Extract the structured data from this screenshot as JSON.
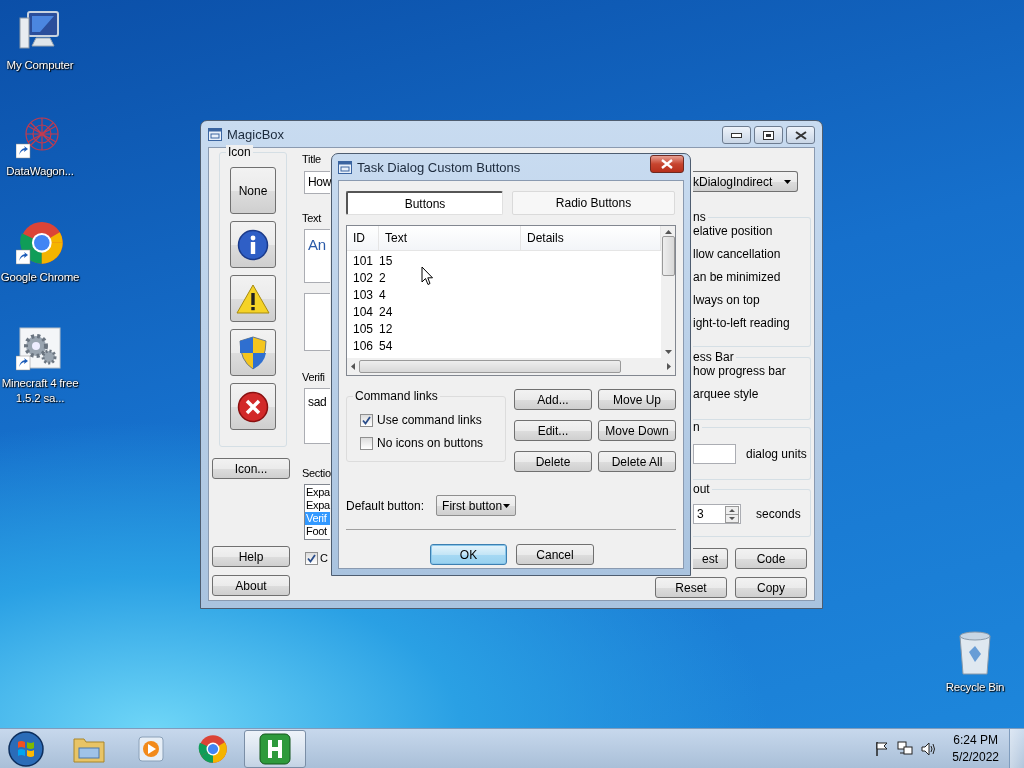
{
  "desktop_icons": [
    {
      "kind": "computer",
      "label": "My Computer",
      "shortcut": false
    },
    {
      "kind": "network",
      "label": "DataWagon...",
      "shortcut": true
    },
    {
      "kind": "chrome",
      "label": "Google Chrome",
      "shortcut": true
    },
    {
      "kind": "gears",
      "label": "Minecraft 4 free 1.5.2 sa...",
      "shortcut": true
    }
  ],
  "recycle_bin": {
    "label": "Recycle Bin"
  },
  "magicbox": {
    "title": "MagicBox",
    "icon_group": {
      "label": "Icon",
      "choices": [
        {
          "kind": "none",
          "label": "None"
        },
        {
          "kind": "info"
        },
        {
          "kind": "warning"
        },
        {
          "kind": "shield"
        },
        {
          "kind": "error"
        }
      ]
    },
    "icon_button": "Icon...",
    "help_button": "Help",
    "about_button": "About",
    "title_label": "Title",
    "title_value": "How",
    "text_label": "Text",
    "text_value": "An",
    "verification_label": "Verifi",
    "verification_value": "sad",
    "sections_label": "Sectio",
    "sections": [
      {
        "label": "Expa",
        "selected": false
      },
      {
        "label": "Expa",
        "selected": false
      },
      {
        "label": "Verif",
        "selected": true
      },
      {
        "label": "Foot",
        "selected": false
      }
    ],
    "option_checkbox": {
      "label": "C",
      "checked": true
    },
    "function_value": "kDialogIndirect",
    "flags_label": "ns",
    "flags": [
      "elative position",
      "llow cancellation",
      "an be minimized",
      "lways on top",
      "ight-to-left reading"
    ],
    "progress_label": "ess Bar",
    "progress_options": [
      "how progress bar",
      "arquee style"
    ],
    "width_label": "n",
    "width_unit": "dialog units",
    "timeout_label": "out",
    "timeout_value": "3",
    "timeout_unit": "seconds",
    "buttons": [
      "est",
      "Code",
      "Reset",
      "Copy"
    ]
  },
  "dialog": {
    "title": "Task Dialog Custom Buttons",
    "tabs": [
      {
        "label": "Buttons",
        "selected": true
      },
      {
        "label": "Radio Buttons",
        "selected": false
      }
    ],
    "columns": [
      "ID",
      "Text",
      "Details"
    ],
    "rows": [
      {
        "id": "101",
        "text": "15"
      },
      {
        "id": "102",
        "text": "2"
      },
      {
        "id": "103",
        "text": "4"
      },
      {
        "id": "104",
        "text": "24"
      },
      {
        "id": "105",
        "text": "12"
      },
      {
        "id": "106",
        "text": "54"
      }
    ],
    "command_links": {
      "label": "Command links",
      "options": [
        {
          "label": "Use command links",
          "checked": true
        },
        {
          "label": "No icons on buttons",
          "checked": false
        }
      ]
    },
    "actions": [
      "Add...",
      "Move Up",
      "Edit...",
      "Move Down",
      "Delete",
      "Delete All"
    ],
    "default_label": "Default button:",
    "default_value": "First button",
    "ok": "OK",
    "cancel": "Cancel"
  },
  "taskbar": {
    "apps": [
      {
        "kind": "explorer",
        "selected": false
      },
      {
        "kind": "media",
        "selected": false
      },
      {
        "kind": "chrome",
        "selected": false
      },
      {
        "kind": "h-app",
        "selected": true
      }
    ],
    "time": "6:24 PM",
    "date": "5/2/2022"
  }
}
